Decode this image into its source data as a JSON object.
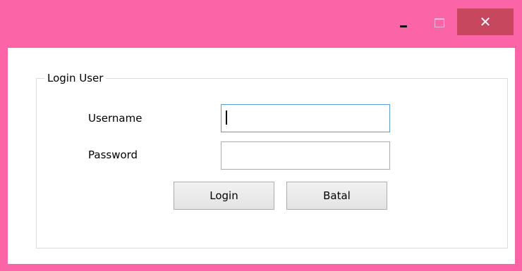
{
  "window": {
    "accent_color": "#fb65a8",
    "close_button_color": "#c7475f",
    "minimize_icon": "minimize-icon",
    "maximize_icon": "maximize-icon",
    "close_icon": "close-icon",
    "close_glyph": "✕"
  },
  "form": {
    "group_title": "Login User",
    "username_label": "Username",
    "password_label": "Password",
    "username_value": "",
    "password_value": "",
    "login_button": "Login",
    "cancel_button": "Batal"
  }
}
